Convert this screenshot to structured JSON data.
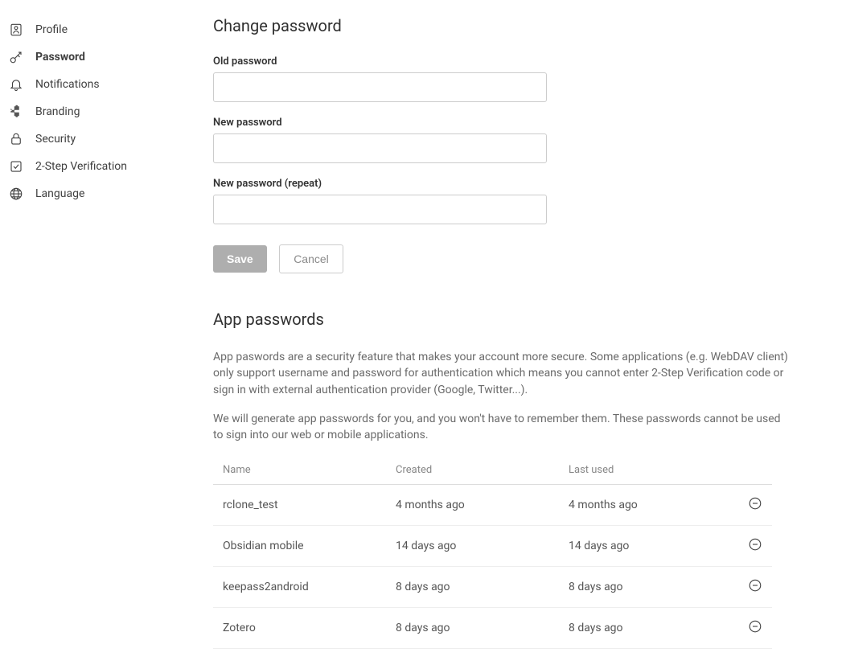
{
  "sidebar": {
    "items": [
      {
        "label": "Profile"
      },
      {
        "label": "Password"
      },
      {
        "label": "Notifications"
      },
      {
        "label": "Branding"
      },
      {
        "label": "Security"
      },
      {
        "label": "2-Step Verification"
      },
      {
        "label": "Language"
      }
    ]
  },
  "changePassword": {
    "title": "Change password",
    "oldLabel": "Old password",
    "newLabel": "New password",
    "repeatLabel": "New password (repeat)",
    "saveLabel": "Save",
    "cancelLabel": "Cancel"
  },
  "appPasswords": {
    "title": "App passwords",
    "desc1": "App paswords are a security feature that makes your account more secure. Some applications (e.g. WebDAV client) only support username and password for authentication which means you cannot enter 2-Step Verification code or sign in with external authentication provider (Google, Twitter...).",
    "desc2": "We will generate app passwords for you, and you won't have to remember them. These passwords cannot be used to sign into our web or mobile applications.",
    "headers": {
      "name": "Name",
      "created": "Created",
      "lastUsed": "Last used"
    },
    "rows": [
      {
        "name": "rclone_test",
        "created": "4 months ago",
        "lastUsed": "4 months ago"
      },
      {
        "name": "Obsidian mobile",
        "created": "14 days ago",
        "lastUsed": "14 days ago"
      },
      {
        "name": "keepass2android",
        "created": "8 days ago",
        "lastUsed": "8 days ago"
      },
      {
        "name": "Zotero",
        "created": "8 days ago",
        "lastUsed": "8 days ago"
      }
    ]
  }
}
